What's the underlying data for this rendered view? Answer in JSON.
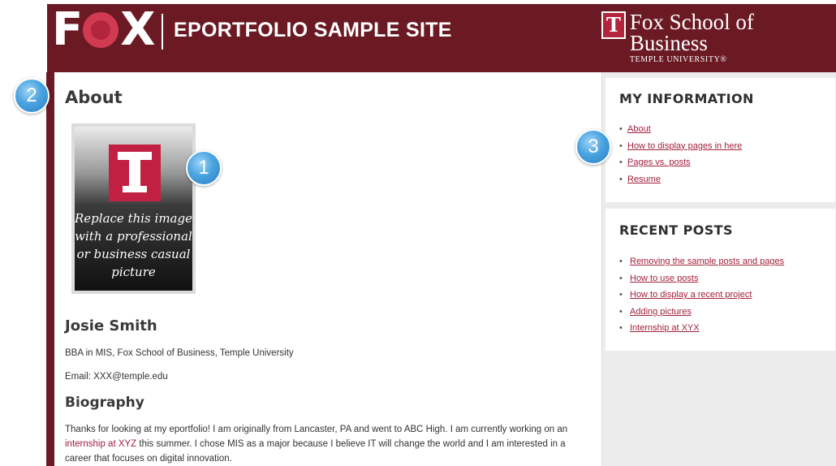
{
  "header": {
    "logo_letters": {
      "f": "F",
      "x": "X"
    },
    "site_title": "EPORTFOLIO SAMPLE SITE",
    "school_logo_letter": "T",
    "school_name": "Fox School of Business",
    "school_sub": "TEMPLE UNIVERSITY",
    "school_sub_mark": "®",
    "colors": {
      "header_bg": "#6b1a24",
      "accent": "#a2203a",
      "logo_red": "#c22042"
    }
  },
  "main": {
    "page_title": "About",
    "photo_caption": "Replace this image\nwith a professional\nor business casual\npicture",
    "name": "Josie Smith",
    "degree": "BBA in MIS, Fox School of Business, Temple University",
    "email": "Email: XXX@temple.edu",
    "bio_heading": "Biography",
    "bio_before": "Thanks for looking at my eportfolio! I am originally from Lancaster, PA and went to ABC High. I am currently working on an ",
    "bio_link": "internship at XYZ",
    "bio_after": " this summer. I chose MIS as a major because I believe IT will change the world and I am interested in a career that focuses on digital innovation."
  },
  "sidebar": {
    "my_information": {
      "title": "MY INFORMATION",
      "items": [
        {
          "label": "About"
        },
        {
          "label": "How to display pages in here"
        },
        {
          "label": "Pages vs. posts"
        },
        {
          "label": "Resume"
        }
      ]
    },
    "recent_posts": {
      "title": "RECENT POSTS",
      "items": [
        {
          "label": "Removing the sample posts and pages"
        },
        {
          "label": "How to use posts"
        },
        {
          "label": "How to display a recent project"
        },
        {
          "label": "Adding pictures"
        },
        {
          "label": "Internship at XYX"
        }
      ]
    }
  },
  "bullet": "•",
  "markers": [
    "1",
    "2",
    "3"
  ]
}
